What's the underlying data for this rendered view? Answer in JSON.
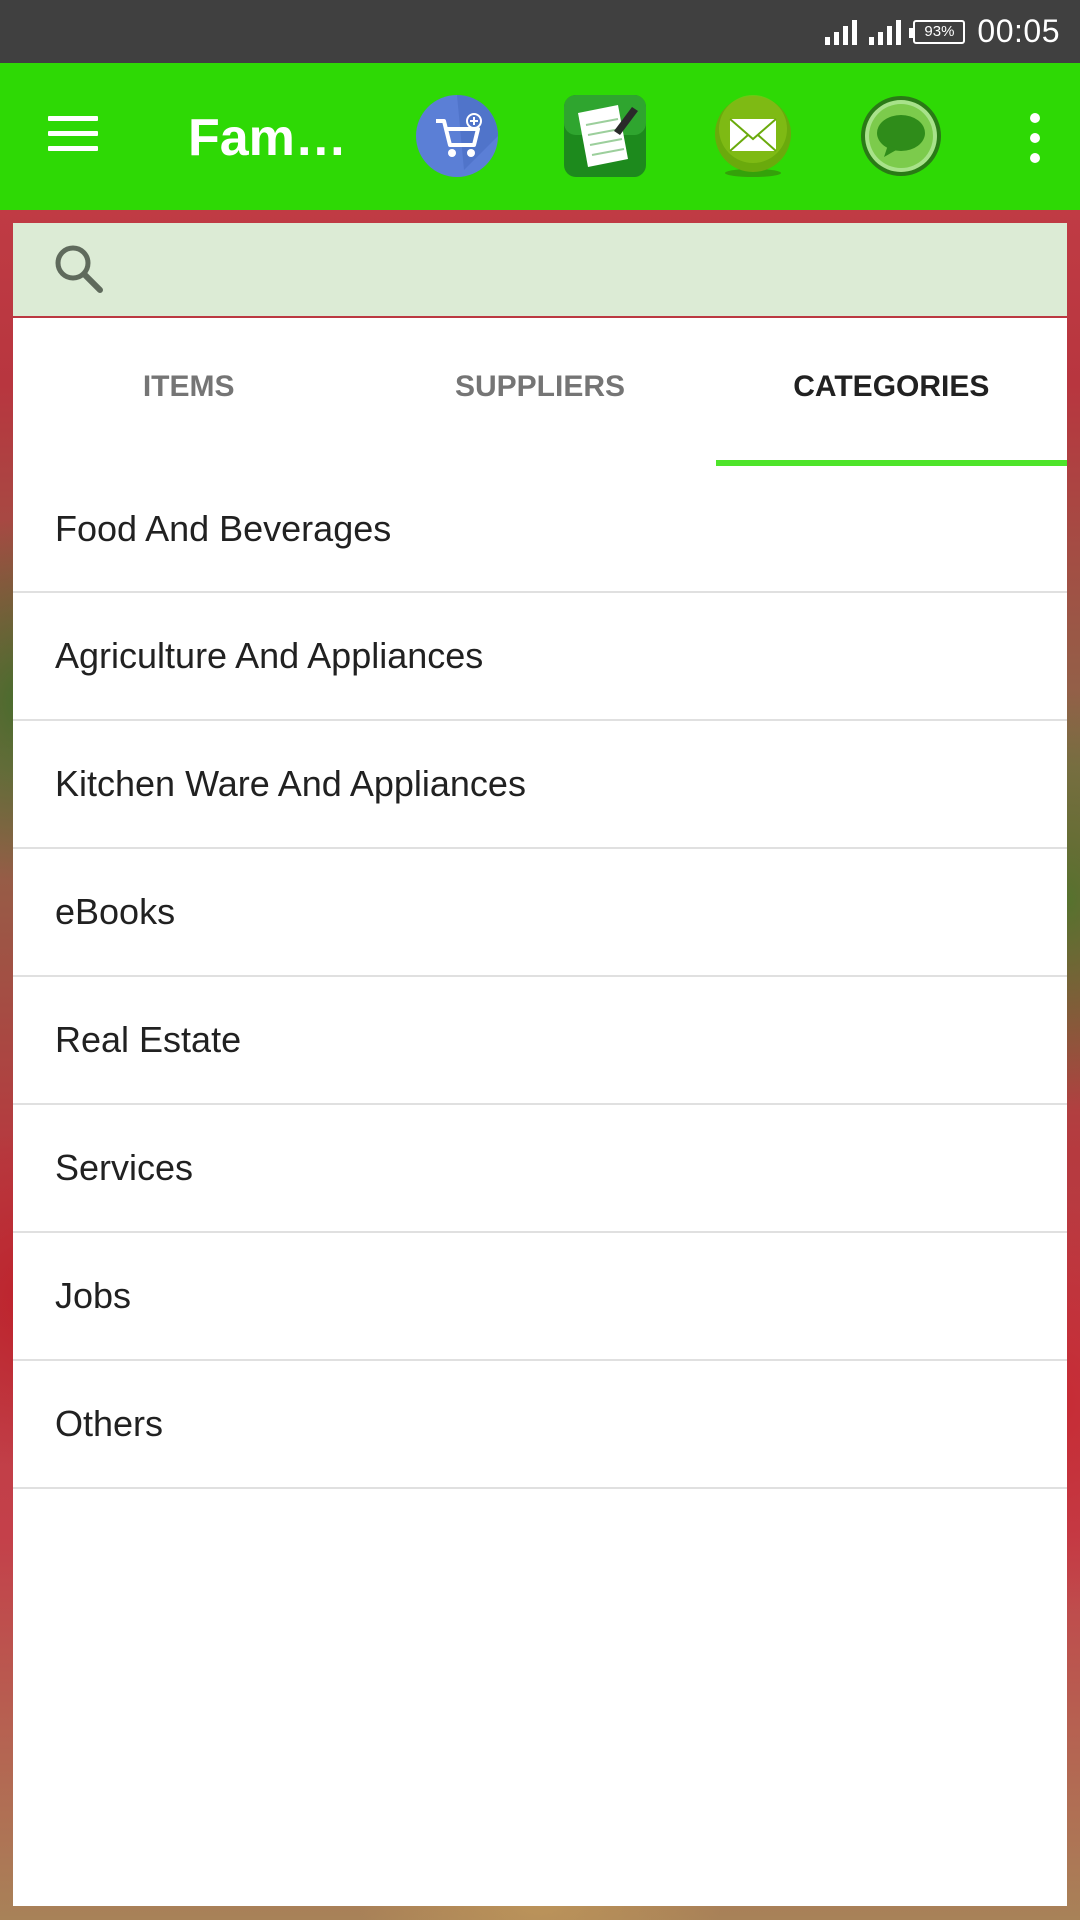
{
  "status_bar": {
    "battery": "93%",
    "time": "00:05"
  },
  "app_bar": {
    "title": "Famu…",
    "icons": [
      "cart-icon",
      "notepad-icon",
      "mail-icon",
      "chat-icon"
    ]
  },
  "search": {
    "placeholder": "",
    "value": ""
  },
  "tabs": [
    {
      "label": "ITEMS",
      "active": false
    },
    {
      "label": "SUPPLIERS",
      "active": false
    },
    {
      "label": "CATEGORIES",
      "active": true
    }
  ],
  "categories": [
    {
      "label": "Food And Beverages"
    },
    {
      "label": "Agriculture And Appliances"
    },
    {
      "label": "Kitchen Ware And Appliances"
    },
    {
      "label": "eBooks"
    },
    {
      "label": "Real Estate"
    },
    {
      "label": "Services"
    },
    {
      "label": "Jobs"
    },
    {
      "label": "Others"
    }
  ],
  "colors": {
    "app_bar": "#2ed905",
    "status_bar": "#404040",
    "tab_indicator": "#4ee42a",
    "search_bg": "#dcebd5"
  }
}
